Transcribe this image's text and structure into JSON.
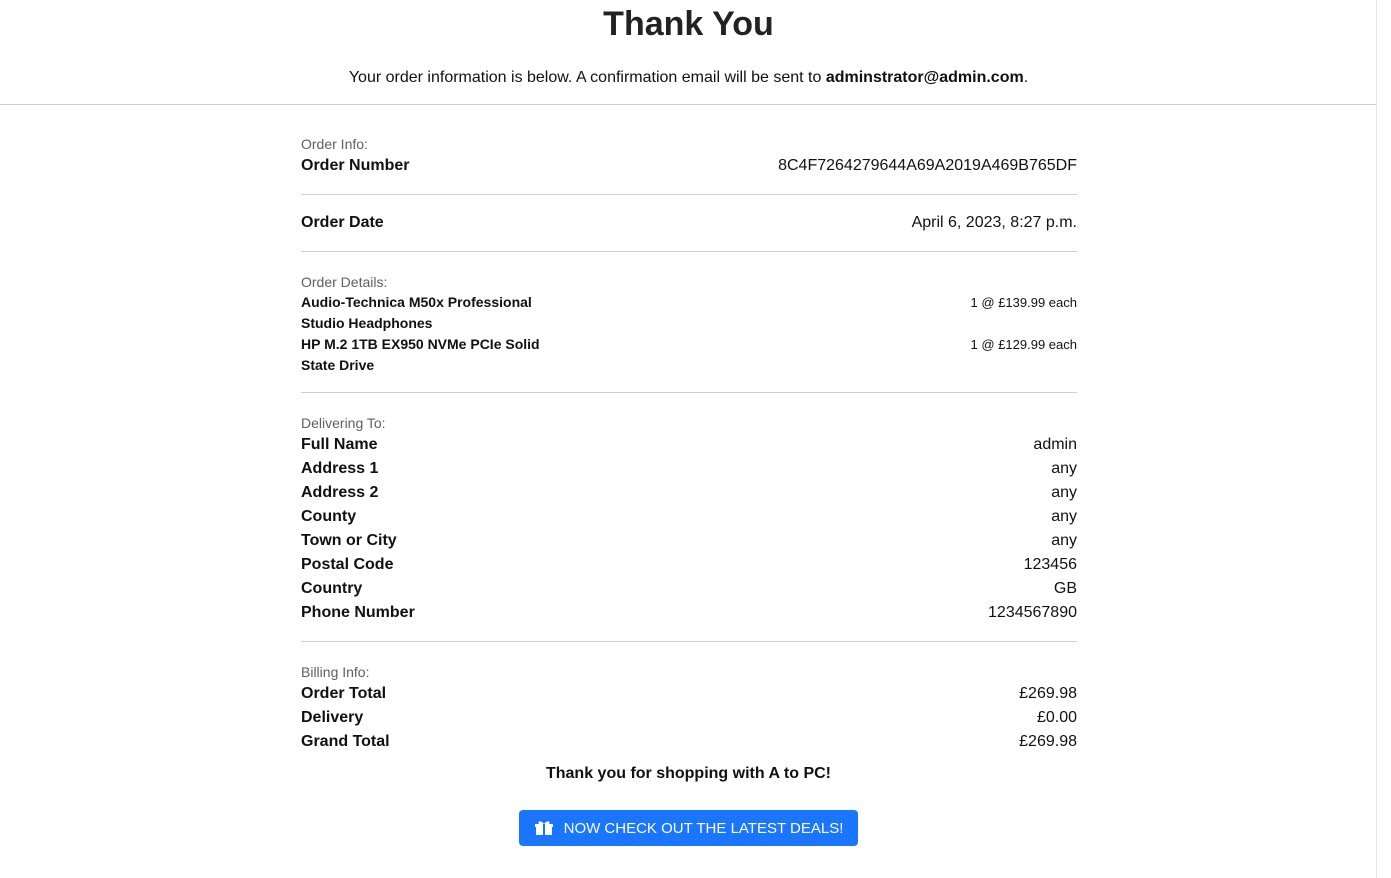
{
  "header": {
    "title": "Thank You",
    "subtitle_prefix": "Your order information is below. A confirmation email will be sent to ",
    "email": "adminstrator@admin.com",
    "subtitle_suffix": "."
  },
  "order_info": {
    "label": "Order Info:",
    "order_number_key": "Order Number",
    "order_number": "8C4F7264279644A69A2019A469B765DF",
    "order_date_key": "Order Date",
    "order_date": "April 6, 2023, 8:27 p.m."
  },
  "order_details": {
    "label": "Order Details:",
    "items": [
      {
        "name": "Audio-Technica M50x Professional Studio Headphones",
        "qty_price": "1 @ £139.99 each"
      },
      {
        "name": "HP M.2 1TB EX950 NVMe PCIe Solid State Drive",
        "qty_price": "1 @ £129.99 each"
      }
    ]
  },
  "delivery": {
    "label": "Delivering To:",
    "rows": [
      {
        "key": "Full Name",
        "value": "admin"
      },
      {
        "key": "Address 1",
        "value": "any"
      },
      {
        "key": "Address 2",
        "value": "any"
      },
      {
        "key": "County",
        "value": "any"
      },
      {
        "key": "Town or City",
        "value": "any"
      },
      {
        "key": "Postal Code",
        "value": "123456"
      },
      {
        "key": "Country",
        "value": "GB"
      },
      {
        "key": "Phone Number",
        "value": "1234567890"
      }
    ]
  },
  "billing": {
    "label": "Billing Info:",
    "rows": [
      {
        "key": "Order Total",
        "value": "£269.98"
      },
      {
        "key": "Delivery",
        "value": "£0.00"
      },
      {
        "key": "Grand Total",
        "value": "£269.98"
      }
    ]
  },
  "footer": {
    "thanks": "Thank you for shopping with A to PC!",
    "button_label": "NOW CHECK OUT THE LATEST DEALS!",
    "button_icon": "gift-icon",
    "button_color": "#1a75ff"
  }
}
